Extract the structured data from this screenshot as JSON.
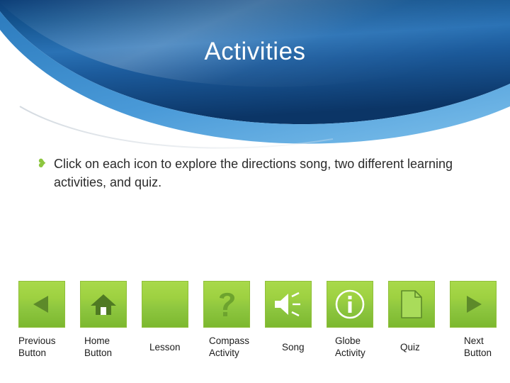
{
  "slide": {
    "title": "Activities",
    "bullet_marker": "❥",
    "bullet_text": "Click on each icon to explore the directions song, two different learning activities, and quiz.",
    "accent_green": "#8dc63f",
    "header_blue": "#1f5fa9",
    "title_color": "#ffffff"
  },
  "buttons": [
    {
      "icon": "previous-triangle-icon",
      "caption": "Previous\nButton",
      "caption_line1": "Previous",
      "caption_line2": "Button"
    },
    {
      "icon": "home-icon",
      "caption": "Home Button",
      "caption_line1": "Home",
      "caption_line2": "Button"
    },
    {
      "icon": "blank-icon",
      "caption": "Lesson",
      "caption_line1": "Lesson",
      "caption_line2": ""
    },
    {
      "icon": "question-mark-icon",
      "caption": "Compass Activity",
      "caption_line1": "Compass",
      "caption_line2": "Activity"
    },
    {
      "icon": "speaker-icon",
      "caption": "Song",
      "caption_line1": "Song",
      "caption_line2": ""
    },
    {
      "icon": "info-circle-icon",
      "caption": "Globe Activity",
      "caption_line1": "Globe",
      "caption_line2": "Activity"
    },
    {
      "icon": "document-page-icon",
      "caption": "Quiz",
      "caption_line1": "Quiz",
      "caption_line2": ""
    },
    {
      "icon": "next-triangle-icon",
      "caption": "Next Button",
      "caption_line1": "Next",
      "caption_line2": "Button"
    }
  ]
}
